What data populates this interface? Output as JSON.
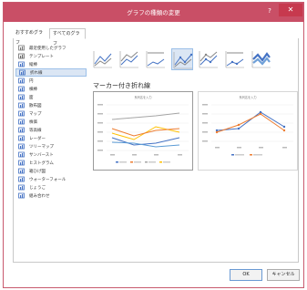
{
  "window": {
    "title": "グラフの種類の変更",
    "help_label": "?",
    "close_label": "✕"
  },
  "tabs": [
    {
      "label": "おすすめグラフ"
    },
    {
      "label": "すべてのグラフ"
    }
  ],
  "sidebar": {
    "items": [
      {
        "label": "最近使用したグラフ",
        "icon": "recent-icon"
      },
      {
        "label": "テンプレート",
        "icon": "template-icon"
      },
      {
        "label": "縦棒",
        "icon": "column-chart-icon"
      },
      {
        "label": "折れ線",
        "icon": "line-chart-icon"
      },
      {
        "label": "円",
        "icon": "pie-chart-icon"
      },
      {
        "label": "横棒",
        "icon": "bar-chart-icon"
      },
      {
        "label": "面",
        "icon": "area-chart-icon"
      },
      {
        "label": "散布図",
        "icon": "scatter-chart-icon"
      },
      {
        "label": "マップ",
        "icon": "map-chart-icon"
      },
      {
        "label": "株価",
        "icon": "stock-chart-icon"
      },
      {
        "label": "等高線",
        "icon": "surface-chart-icon"
      },
      {
        "label": "レーダー",
        "icon": "radar-chart-icon"
      },
      {
        "label": "ツリーマップ",
        "icon": "treemap-chart-icon"
      },
      {
        "label": "サンバースト",
        "icon": "sunburst-chart-icon"
      },
      {
        "label": "ヒストグラム",
        "icon": "histogram-chart-icon"
      },
      {
        "label": "箱ひげ図",
        "icon": "box-whisker-chart-icon"
      },
      {
        "label": "ウォーターフォール",
        "icon": "waterfall-chart-icon"
      },
      {
        "label": "じょうご",
        "icon": "funnel-chart-icon"
      },
      {
        "label": "組み合わせ",
        "icon": "combo-chart-icon"
      }
    ],
    "selected_index": 3
  },
  "chart_types": {
    "selected_index": 3,
    "items": [
      {
        "icon": "line-icon"
      },
      {
        "icon": "stacked-line-icon"
      },
      {
        "icon": "100-stacked-line-icon"
      },
      {
        "icon": "line-with-markers-icon"
      },
      {
        "icon": "stacked-line-with-markers-icon"
      },
      {
        "icon": "100-stacked-line-with-markers-icon"
      },
      {
        "icon": "3d-line-icon"
      }
    ]
  },
  "selected_type_title": "マーカー付き折れ線",
  "previews": [
    {
      "title": "系列名を入力"
    },
    {
      "title": "系列名を入力"
    }
  ],
  "buttons": {
    "ok": "OK",
    "cancel": "キャンセル"
  },
  "colors": {
    "title_bar": "#c94f66",
    "close_button": "#c7394e",
    "selection_fill": "#dbe6f4",
    "selection_border": "#9cc0e8",
    "series_blue": "#4472c4",
    "series_orange": "#ed7d31",
    "series_gray": "#a5a5a5",
    "series_gold": "#ffc000",
    "series_light_blue": "#5b9bd5"
  }
}
